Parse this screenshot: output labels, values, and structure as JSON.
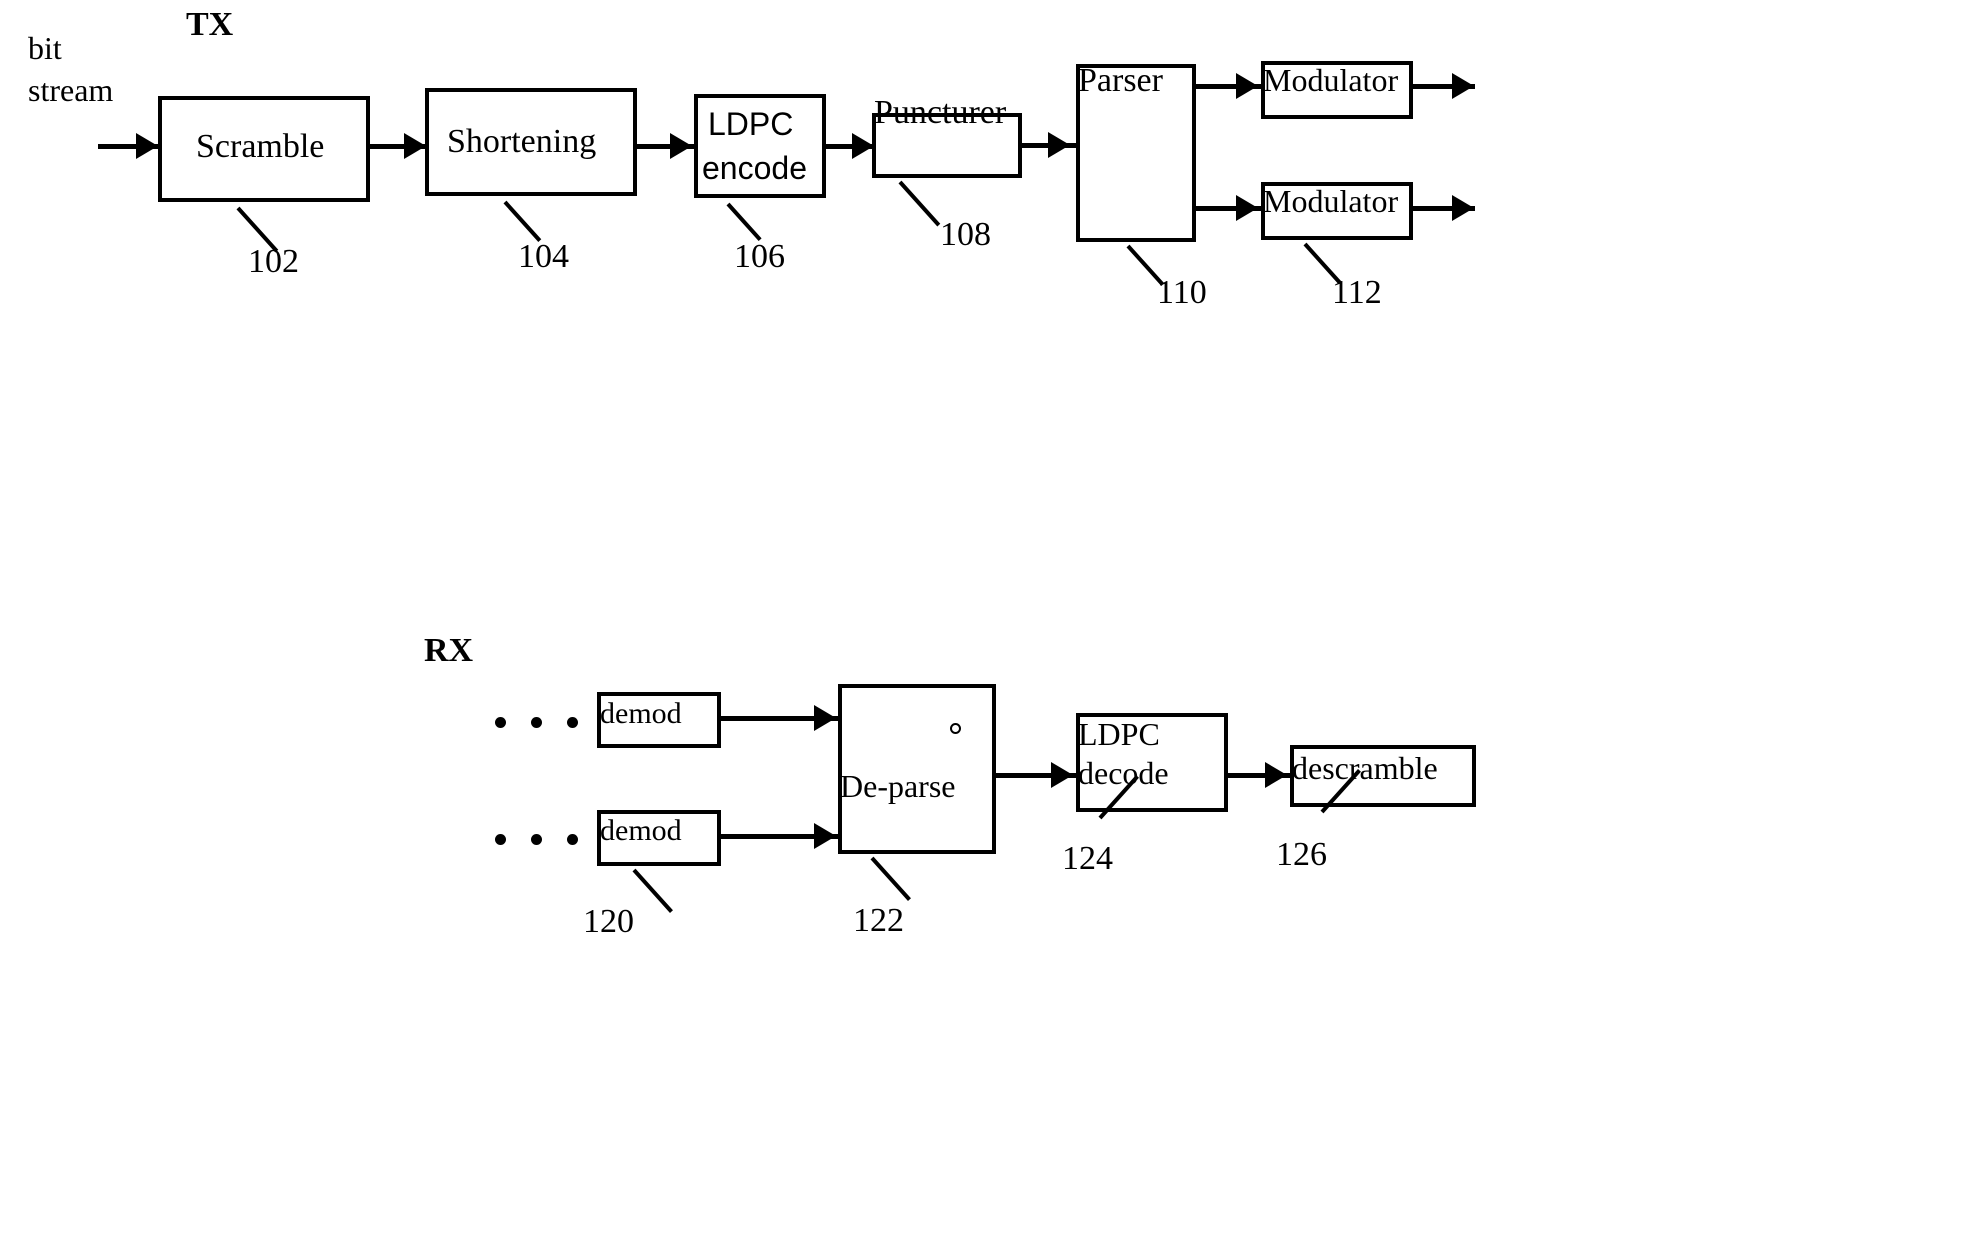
{
  "diagram": {
    "title_tx": "TX",
    "title_rx": "RX",
    "input_label_line1": "bit",
    "input_label_line2": "stream"
  },
  "tx": {
    "blocks": [
      {
        "id": "scramble",
        "label": "Scramble",
        "ref": "102"
      },
      {
        "id": "shortening",
        "label": "Shortening",
        "ref": "104"
      },
      {
        "id": "ldpc_encode",
        "label_line1": "LDPC",
        "label_line2": "encode",
        "ref": "106"
      },
      {
        "id": "puncturer",
        "label": "Puncturer",
        "ref": "108"
      },
      {
        "id": "parser",
        "label": "Parser",
        "ref": "110"
      },
      {
        "id": "modulator_1",
        "label": "Modulator",
        "ref": "112"
      },
      {
        "id": "modulator_2",
        "label": "Modulator",
        "ref": ""
      }
    ]
  },
  "rx": {
    "blocks": [
      {
        "id": "demod_1",
        "label": "demod",
        "ref": "120"
      },
      {
        "id": "demod_2",
        "label": "demod",
        "ref": ""
      },
      {
        "id": "de_parse",
        "label": "De-parse",
        "ref": "122"
      },
      {
        "id": "ldpc_decode",
        "label_line1": "LDPC",
        "label_line2": "decode",
        "ref": "124"
      },
      {
        "id": "descramble",
        "label": "descramble",
        "ref": "126"
      }
    ],
    "ellipsis": "..."
  },
  "colors": {
    "stroke": "#000000",
    "background": "#ffffff"
  }
}
